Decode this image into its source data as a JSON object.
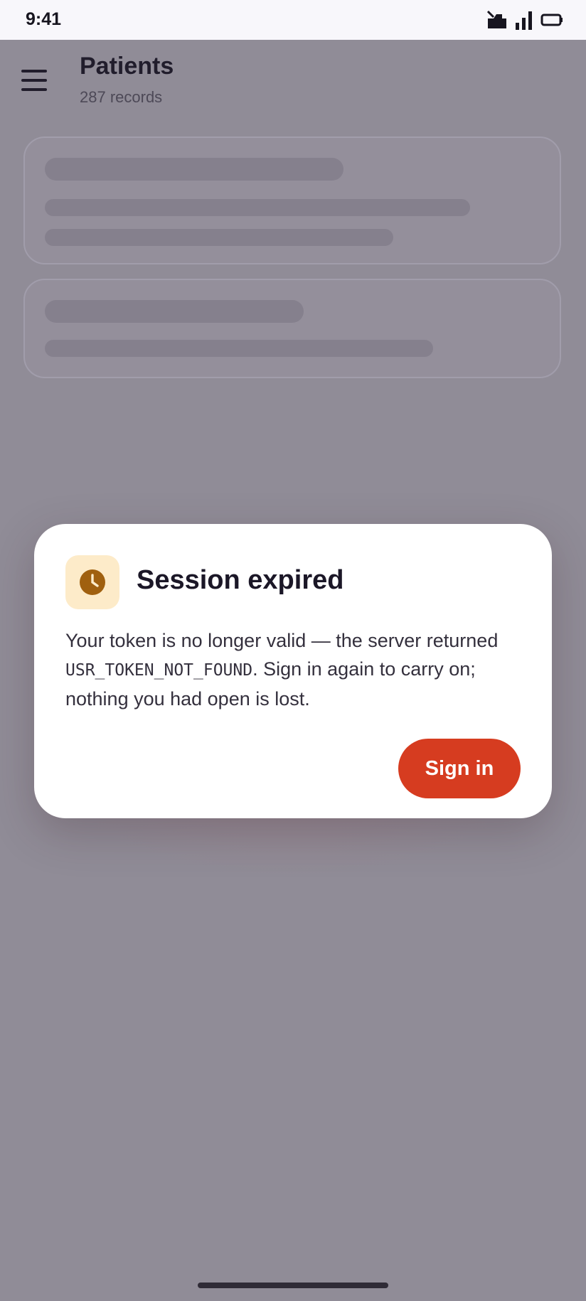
{
  "status_bar": {
    "time": "9:41",
    "icons": [
      "notification-icon",
      "signal-icon",
      "battery-icon"
    ]
  },
  "header": {
    "title": "Patients",
    "subtitle": "287 records",
    "menu_icon": "hamburger-menu-icon"
  },
  "dialog": {
    "icon": "clock-icon",
    "title": "Session expired",
    "body_before": "Your token is no longer valid — the server returned ",
    "code": "USR_TOKEN_NOT_FOUND",
    "body_after": ". Sign in again to carry on; nothing you had open is lost.",
    "primary_button": "Sign in"
  },
  "colors": {
    "accent": "#d63c20",
    "icon_bg": "#fdebc9",
    "icon_fg": "#a0600f",
    "scrim": "#908c97"
  }
}
